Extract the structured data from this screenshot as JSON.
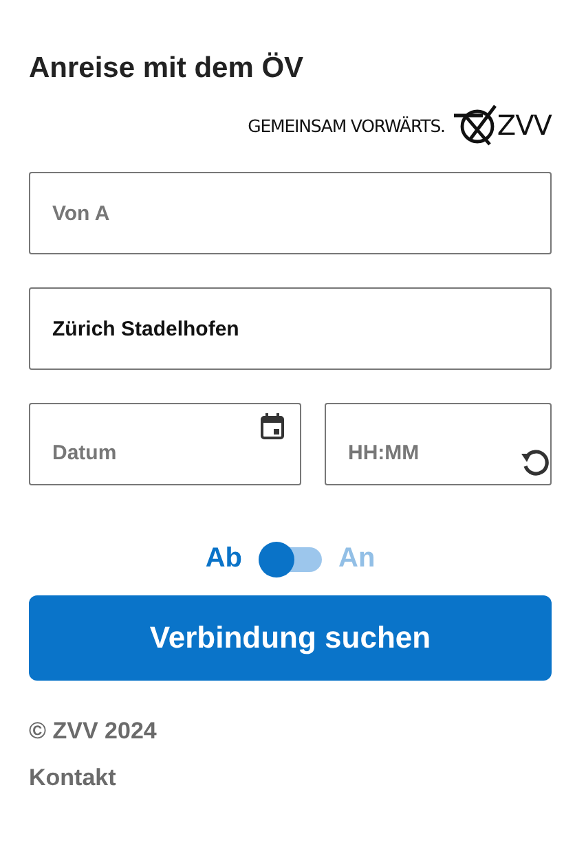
{
  "title": "Anreise mit dem ÖV",
  "logo": {
    "tagline": "GEMEINSAM VORWÄRTS.",
    "name": "ZVV"
  },
  "fields": [
    {
      "kind": "text",
      "placeholder": "Von A"
    },
    {
      "kind": "text",
      "value": "Zürich Stadelhofen"
    }
  ],
  "date_field": {
    "placeholder": "Datum"
  },
  "time_field": {
    "placeholder": "HH:MM"
  },
  "toggle": {
    "left_label": "Ab",
    "right_label": "An",
    "on": false
  },
  "search_button": "Verbindung suchen",
  "footer": {
    "copyright": "© ZVV 2024",
    "link": "Kontakt"
  }
}
